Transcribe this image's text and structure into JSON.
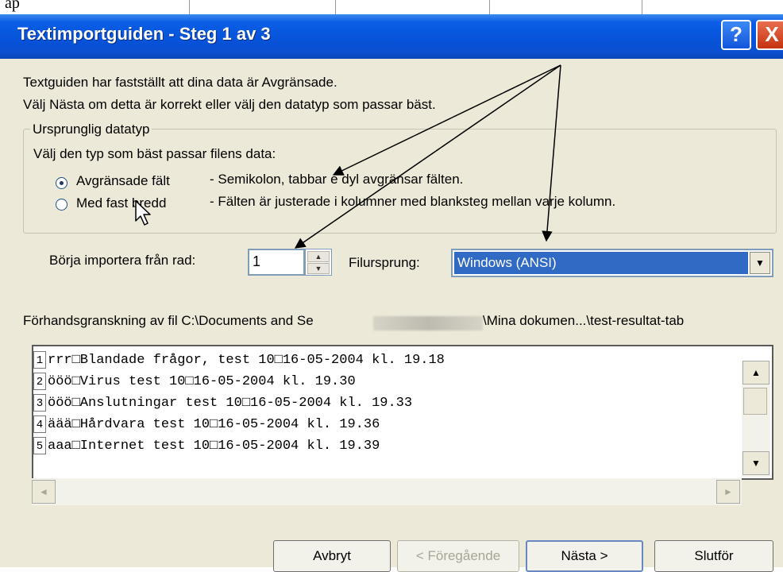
{
  "top_fragment": "ap",
  "window": {
    "title": "Textimportguiden - Steg 1 av 3",
    "help_label": "?",
    "close_label": "X"
  },
  "intro": {
    "line1": "Textguiden har fastställt att dina data är Avgränsade.",
    "line2": "Välj Nästa om detta är korrekt eller välj den datatyp som passar bäst."
  },
  "group": {
    "legend": "Ursprunglig datatyp",
    "prompt": "Välj den typ som bäst passar filens data:",
    "options": [
      {
        "label": "Avgränsade fält",
        "desc": "- Semikolon, tabbar e dyl avgränsar fälten.",
        "selected": true
      },
      {
        "label": "Med fast bredd",
        "desc": "- Fälten är justerade i kolumner med blanksteg mellan varje kolumn.",
        "selected": false
      }
    ]
  },
  "start_row": {
    "label": "Börja importera från rad:",
    "value": "1"
  },
  "file_origin": {
    "label": "Filursprung:",
    "value": "Windows (ANSI)"
  },
  "preview": {
    "label_start": "Förhandsgranskning av fil C:\\Documents and Se",
    "label_end": "\\Mina dokumen...\\test-resultat-tab",
    "lines": [
      {
        "num": "1",
        "text": "rrr□Blandade frågor, test 10□16-05-2004 kl. 19.18"
      },
      {
        "num": "2",
        "text": "ööö□Virus test 10□16-05-2004 kl. 19.30"
      },
      {
        "num": "3",
        "text": "ööö□Anslutningar test 10□16-05-2004 kl. 19.33"
      },
      {
        "num": "4",
        "text": "äää□Hårdvara test 10□16-05-2004 kl. 19.36"
      },
      {
        "num": "5",
        "text": "aaa□Internet test 10□16-05-2004 kl. 19.39"
      }
    ]
  },
  "buttons": {
    "cancel": "Avbryt",
    "back": "< Föregående",
    "next": "Nästa >",
    "finish": "Slutför"
  },
  "icons": {
    "radio_selected": "radio-selected-icon",
    "spin_up": "▲",
    "spin_down": "▼",
    "dropdown": "▼",
    "scroll_left": "◄",
    "scroll_right": "►"
  }
}
